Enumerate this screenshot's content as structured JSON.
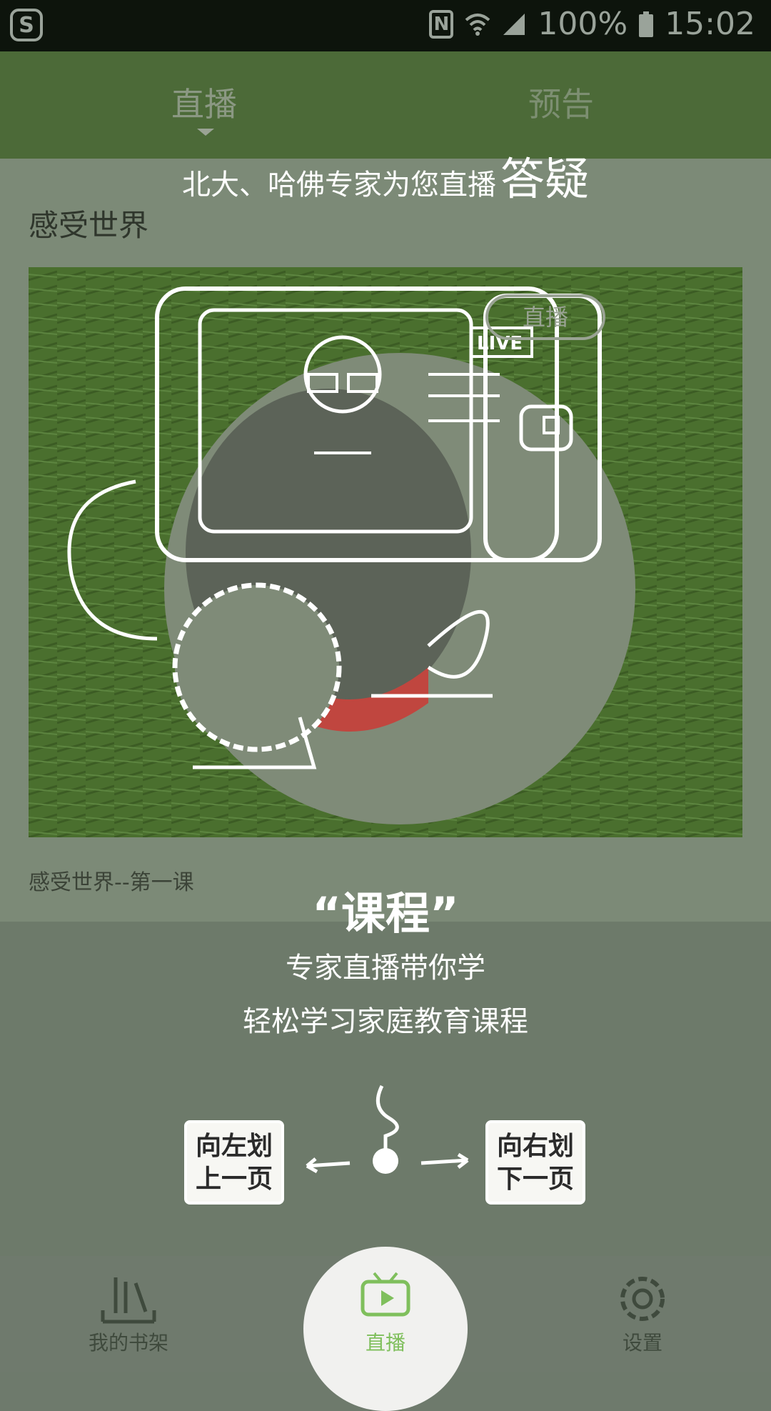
{
  "status_bar": {
    "battery": "100%",
    "time": "15:02",
    "icons": [
      "sogou-s-icon",
      "nfc-icon",
      "wifi-icon",
      "signal-icon",
      "battery-icon"
    ]
  },
  "tabs": {
    "live": "直播",
    "preview": "预告"
  },
  "guide": {
    "top_text": "北大、哈佛专家为您直播",
    "top_emph": "答疑",
    "heading": "“课程”",
    "line1": "专家直播带你学",
    "line2": "轻松学习家庭教育课程",
    "swipe_left_l1": "向左划",
    "swipe_left_l2": "上一页",
    "swipe_right_l1": "向右划",
    "swipe_right_l2": "下一页"
  },
  "content": {
    "section_title": "感受世界",
    "cover_badge": "直播",
    "tv_live_label": "LIVE",
    "course_title": "感受世界--第一课"
  },
  "bottom_nav": {
    "shelf": "我的书架",
    "live": "直播",
    "settings": "设置"
  },
  "colors": {
    "status_bar": "#0d140c",
    "tab_bar": "#4c6a38",
    "content_dim": "#7c8a77",
    "accent_green": "#7fbf5c"
  }
}
